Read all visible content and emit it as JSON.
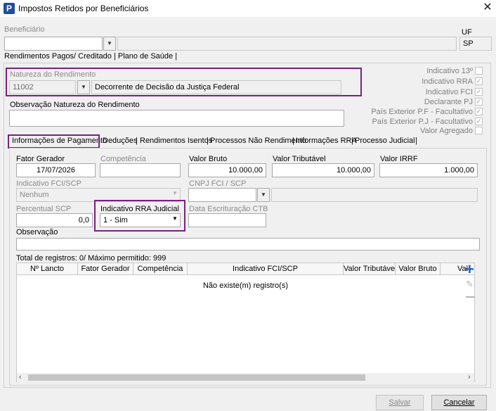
{
  "window": {
    "title": "Impostos Retidos por Beneficiários",
    "app_icon": "P",
    "close": "✕"
  },
  "beneficiario": {
    "label": "Beneficiário",
    "value": "",
    "name": "",
    "uf_label": "UF",
    "uf_value": "SP"
  },
  "top_tabs": [
    "Rendimentos Pagos/ Creditado",
    "Plano de Saúde"
  ],
  "natureza": {
    "label": "Natureza do Rendimento",
    "code": "11002",
    "description": "Decorrente de Decisão da Justiça Federal"
  },
  "observacao_natureza": {
    "label": "Observação Natureza do Rendimento",
    "value": ""
  },
  "checkboxes": [
    {
      "label": "Indicativo 13º",
      "checked": false
    },
    {
      "label": "Indicativo RRA",
      "checked": true
    },
    {
      "label": "Indicativo FCI",
      "checked": true
    },
    {
      "label": "Declarante PJ",
      "checked": true
    },
    {
      "label": "País Exterior P.F - Facultativo",
      "checked": true
    },
    {
      "label": "País Exterior P.J - Facultativo",
      "checked": true
    },
    {
      "label": "Valor Agregado",
      "checked": false
    }
  ],
  "sub_tabs": [
    "Informações de Pagamento",
    "Deduções",
    "Rendimentos Isentos",
    "Processos Não Rendimento",
    "Informações RRA",
    "Processo Judicial"
  ],
  "pagamento": {
    "fato_gerador": {
      "label": "Fator Gerador",
      "value": "17/07/2026"
    },
    "competencia": {
      "label": "Competência",
      "value": ""
    },
    "valor_bruto": {
      "label": "Valor Bruto",
      "value": "10.000,00"
    },
    "valor_tributavel": {
      "label": "Valor Tributável",
      "value": "10.000,00"
    },
    "valor_irrf": {
      "label": "Valor IRRF",
      "value": "1.000,00"
    },
    "indicativo_fci": {
      "label": "Indicativo FCI/SCP",
      "value": "Nenhum"
    },
    "cnpj_fci": {
      "label": "CNPJ FCI / SCP",
      "value": "",
      "name": ""
    },
    "percentual_scp": {
      "label": "Percentual SCP",
      "value": "0,0"
    },
    "indicativo_rra": {
      "label": "Indicativo RRA Judicial",
      "value": "1 - Sim"
    },
    "data_escrituracao": {
      "label": "Data Escrituração CTB",
      "value": ""
    },
    "observacao": {
      "label": "Observação",
      "value": ""
    }
  },
  "grid": {
    "total_text": "Total de registros: 0/ Máximo permitido: 999",
    "columns": [
      "Nº Lancto",
      "Fator Gerador",
      "Competência",
      "Indicativo FCI/SCP",
      "Valor Tributável",
      "Valor Bruto",
      "Val"
    ],
    "empty_text": "Não existe(m) registro(s)"
  },
  "buttons": {
    "save": "Salvar",
    "cancel": "Cancelar"
  },
  "colors": {
    "highlight": "#7a2180",
    "add_icon": "#1f5fbf"
  }
}
